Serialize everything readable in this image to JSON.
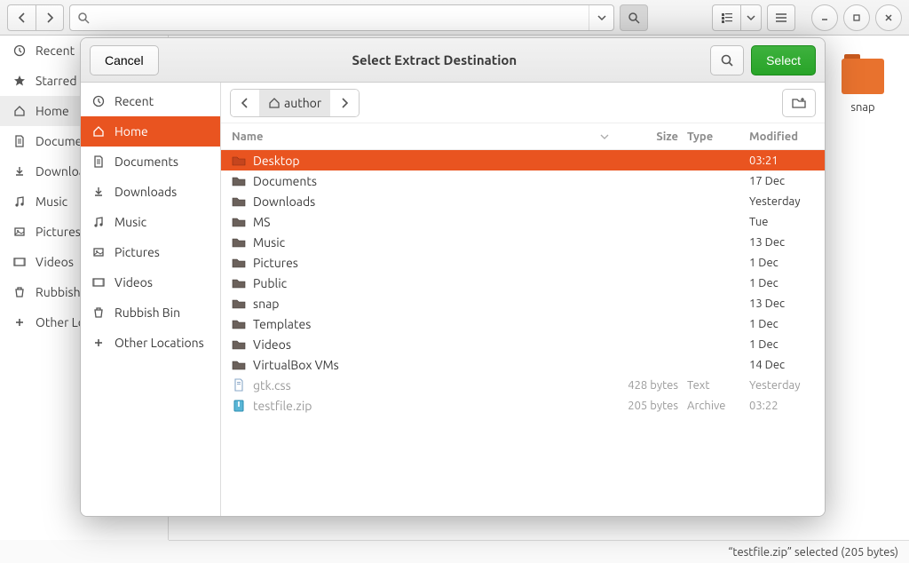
{
  "bg": {
    "sidebar": [
      {
        "label": "Recent",
        "icon": "clock"
      },
      {
        "label": "Starred",
        "icon": "star"
      },
      {
        "label": "Home",
        "icon": "home",
        "active": true
      },
      {
        "label": "Documents",
        "icon": "doc"
      },
      {
        "label": "Downloads",
        "icon": "download"
      },
      {
        "label": "Music",
        "icon": "music"
      },
      {
        "label": "Pictures",
        "icon": "picture"
      },
      {
        "label": "Videos",
        "icon": "video"
      },
      {
        "label": "Rubbish Bin",
        "icon": "trash"
      },
      {
        "label": "Other Locations",
        "icon": "plus"
      }
    ],
    "snap_label": "snap",
    "status": "“testfile.zip” selected  (205 bytes)"
  },
  "dialog": {
    "title": "Select Extract Destination",
    "cancel": "Cancel",
    "select": "Select",
    "breadcrumb": "author",
    "sidebar": [
      {
        "label": "Recent",
        "icon": "clock"
      },
      {
        "label": "Home",
        "icon": "home",
        "selected": true
      },
      {
        "label": "Documents",
        "icon": "doc"
      },
      {
        "label": "Downloads",
        "icon": "download"
      },
      {
        "label": "Music",
        "icon": "music"
      },
      {
        "label": "Pictures",
        "icon": "picture"
      },
      {
        "label": "Videos",
        "icon": "video"
      },
      {
        "label": "Rubbish Bin",
        "icon": "trash"
      },
      {
        "label": "Other Locations",
        "icon": "plus"
      }
    ],
    "cols": {
      "name": "Name",
      "size": "Size",
      "type": "Type",
      "mod": "Modified"
    },
    "rows": [
      {
        "name": "Desktop",
        "icon": "folder",
        "mod": "03:21",
        "selected": true
      },
      {
        "name": "Documents",
        "icon": "folder",
        "mod": "17 Dec"
      },
      {
        "name": "Downloads",
        "icon": "folder",
        "mod": "Yesterday"
      },
      {
        "name": "MS",
        "icon": "folder",
        "mod": "Tue"
      },
      {
        "name": "Music",
        "icon": "folder",
        "mod": "13 Dec"
      },
      {
        "name": "Pictures",
        "icon": "folder",
        "mod": "1 Dec"
      },
      {
        "name": "Public",
        "icon": "folder",
        "mod": "1 Dec"
      },
      {
        "name": "snap",
        "icon": "folder",
        "mod": "13 Dec"
      },
      {
        "name": "Templates",
        "icon": "folder",
        "mod": "1 Dec"
      },
      {
        "name": "Videos",
        "icon": "folder",
        "mod": "1 Dec"
      },
      {
        "name": "VirtualBox VMs",
        "icon": "folder",
        "mod": "14 Dec"
      },
      {
        "name": "gtk.css",
        "icon": "file",
        "size": "428 bytes",
        "type": "Text",
        "mod": "Yesterday",
        "dim": true
      },
      {
        "name": "testfile.zip",
        "icon": "zip",
        "size": "205 bytes",
        "type": "Archive",
        "mod": "03:22",
        "dim": true
      }
    ]
  }
}
